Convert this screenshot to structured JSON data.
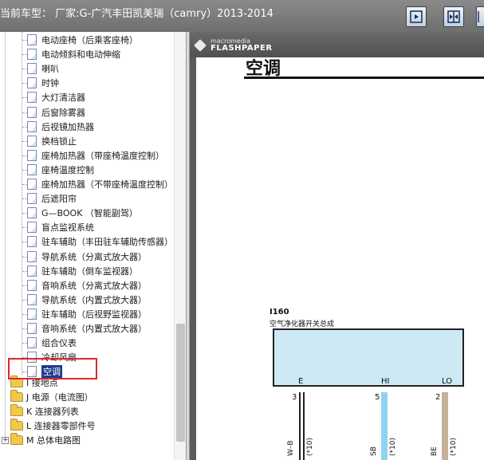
{
  "header": {
    "title": "当前车型： 厂家:G-广汽丰田凯美瑞（camry）2013-2014",
    "buttons": [
      {
        "name": "show-right-pane-button",
        "icon": "panel-right-icon"
      },
      {
        "name": "split-panes-button",
        "icon": "panel-split-icon"
      },
      {
        "name": "show-left-pane-button",
        "icon": "panel-left-icon"
      }
    ]
  },
  "tree": {
    "items": [
      "电动座椅（后乘客座椅）",
      "电动倾斜和电动伸缩",
      "喇叭",
      "时钟",
      "大灯清洁器",
      "后窗除雾器",
      "后视镜加热器",
      "换档锁止",
      "座椅加热器（带座椅温度控制）",
      "座椅温度控制",
      "座椅加热器（不带座椅温度控制）",
      "后遮阳帘",
      "G—BOOK （智能副驾）",
      "盲点监视系统",
      "驻车辅助（丰田驻车辅助传感器）",
      "导航系统（分离式放大器）",
      "驻车辅助（倒车监视器）",
      "音响系统（分离式放大器）",
      "导航系统（内置式放大器）",
      "驻车辅助（后视野监视器）",
      "音响系统（内置式放大器）",
      "组合仪表",
      "冷却风扇",
      "空调"
    ],
    "selected_index": 23,
    "top_folders": [
      {
        "label": "I 接地点",
        "expandable": false
      },
      {
        "label": "J 电源（电流图）",
        "expandable": false
      },
      {
        "label": "K 连接器列表",
        "expandable": false
      },
      {
        "label": "L 连接器零部件号",
        "expandable": false
      },
      {
        "label": "M 总体电路图",
        "expandable": true,
        "expander": "+"
      }
    ]
  },
  "viewer": {
    "brand_top": "macromedia",
    "brand_bottom": "FLASHPAPER",
    "page_title": "空调",
    "connector": {
      "id": "I160",
      "name": "空气净化器开关总成",
      "pins": [
        {
          "name": "E",
          "number": "3",
          "wire": "W–B",
          "note": "(*10)",
          "color": "#222222"
        },
        {
          "name": "HI",
          "number": "5",
          "wire": "SB",
          "note": "(*10)",
          "color": "#8fd3ef"
        },
        {
          "name": "LO",
          "number": "2",
          "wire": "BE",
          "note": "(*10)",
          "color": "#c4b19a"
        }
      ]
    }
  },
  "colors": {
    "header_bg": "#7a7a7a",
    "selection_bg": "#1c3c8c",
    "highlight_border": "#e0262a",
    "connector_fill": "#cde9f4"
  }
}
